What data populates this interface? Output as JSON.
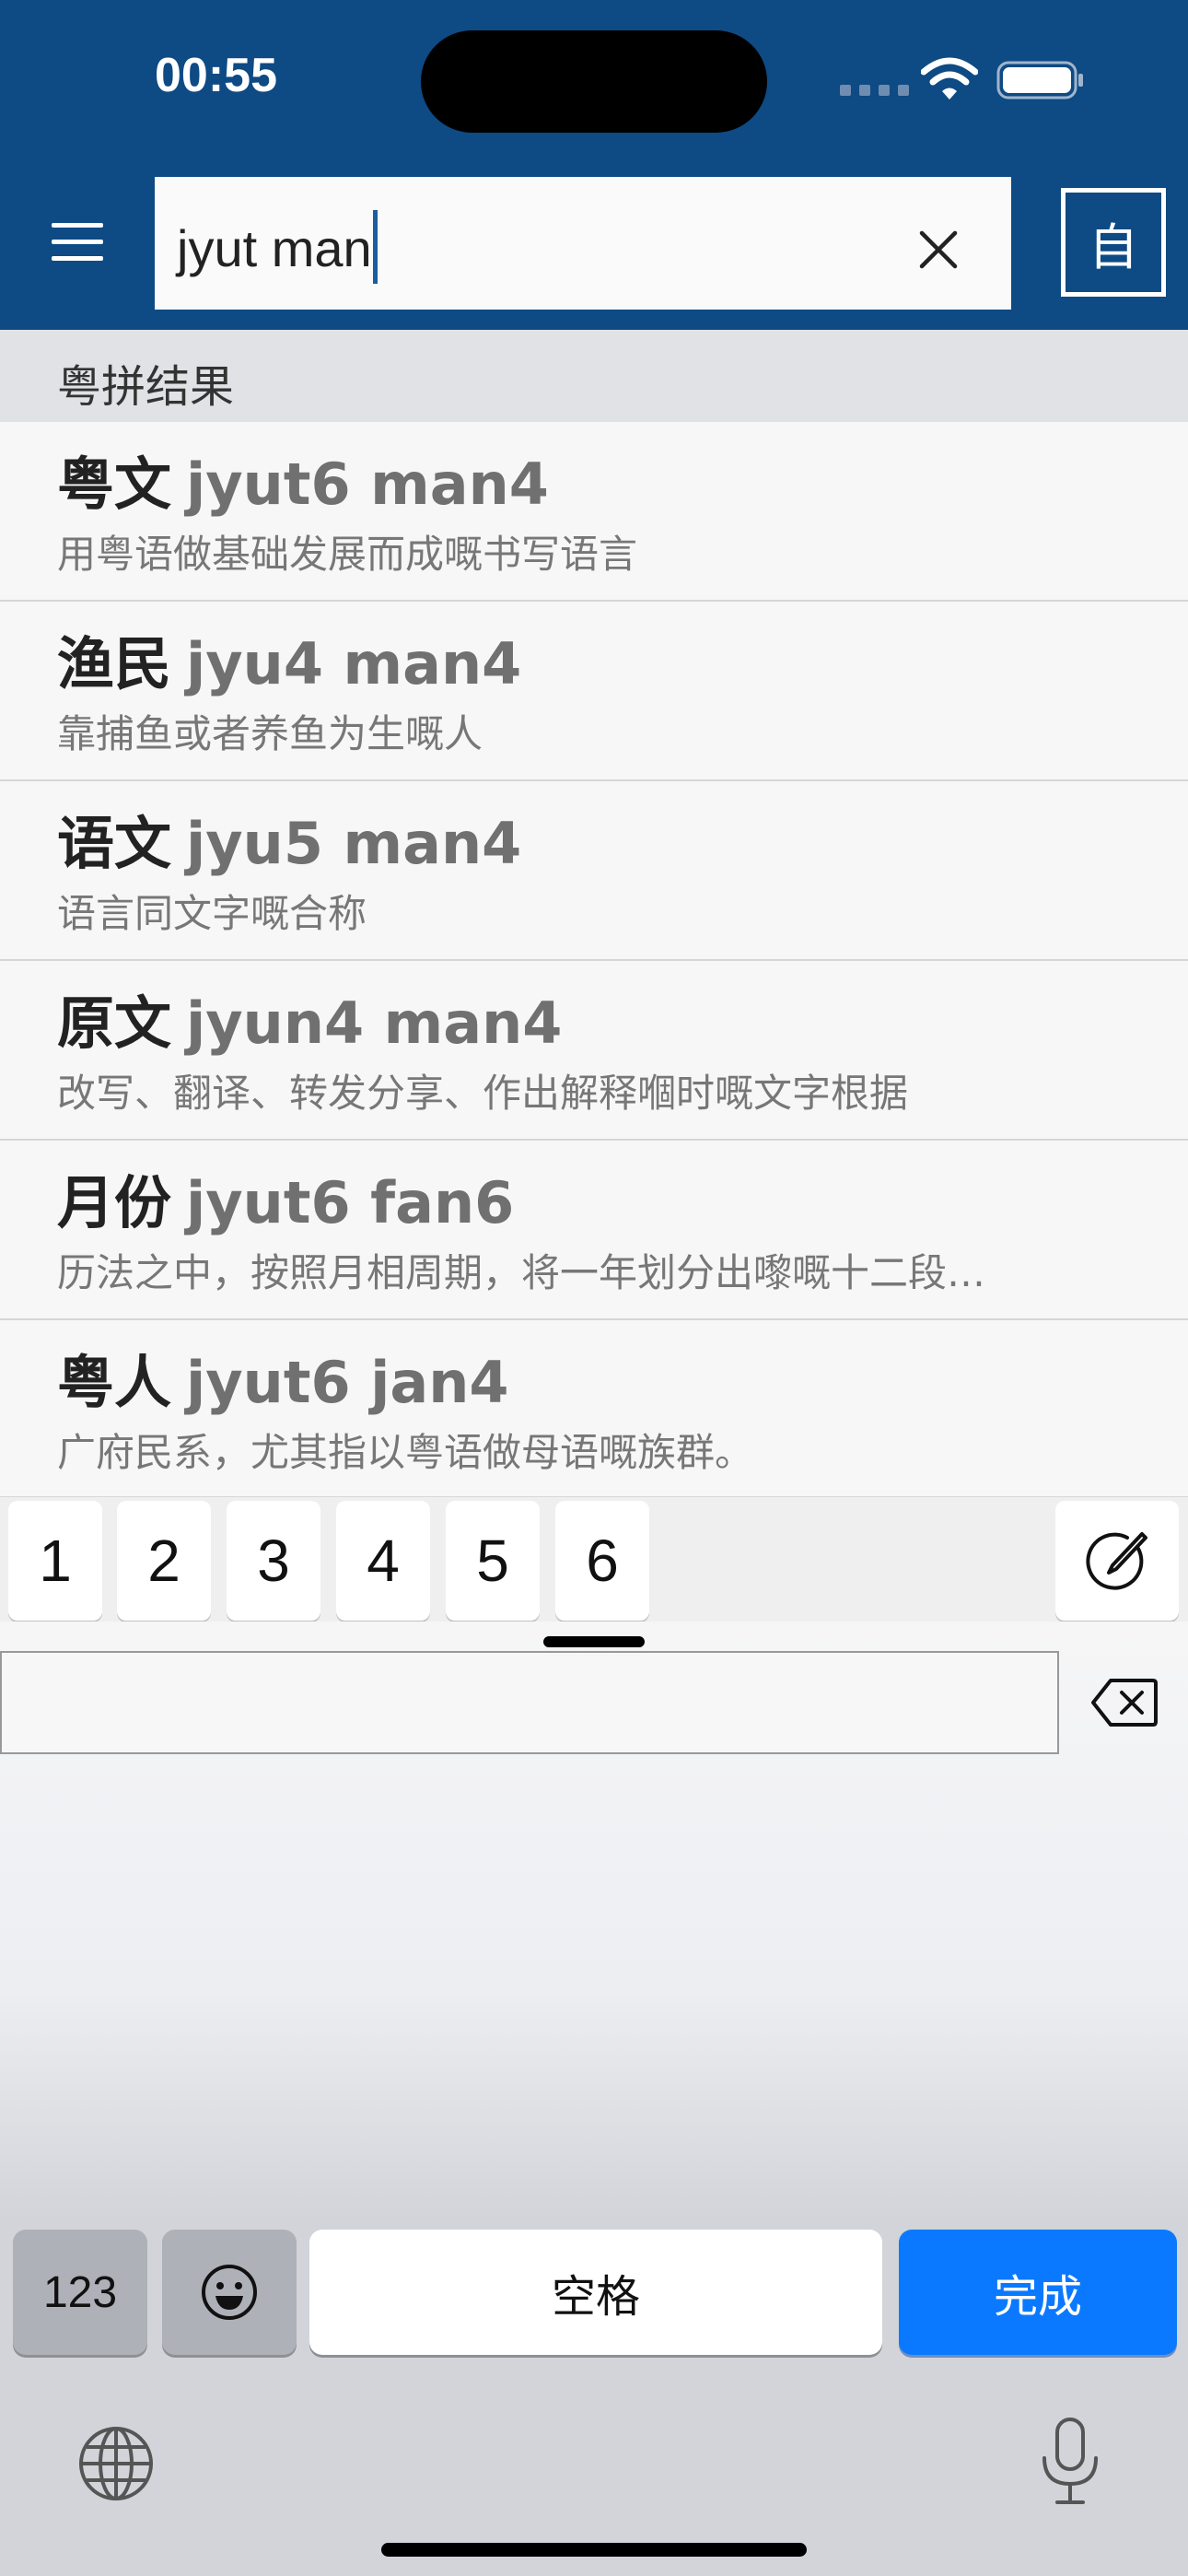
{
  "status_bar": {
    "time": "00:55"
  },
  "search": {
    "query": "jyut man",
    "mode_button": "自"
  },
  "results_section": {
    "title": "粤拼结果",
    "items": [
      {
        "word": "粤文",
        "jyutping": "jyut6 man4",
        "definition": "用粤语做基础发展而成嘅书写语言"
      },
      {
        "word": "渔民",
        "jyutping": "jyu4 man4",
        "definition": "靠捕鱼或者养鱼为生嘅人"
      },
      {
        "word": "语文",
        "jyutping": "jyu5 man4",
        "definition": "语言同文字嘅合称"
      },
      {
        "word": "原文",
        "jyutping": "jyun4 man4",
        "definition": "改写、翻译、转发分享、作出解释嗰时嘅文字根据"
      },
      {
        "word": "月份",
        "jyutping": "jyut6 fan6",
        "definition": "历法之中，按照月相周期，将一年划分出嚟嘅十二段…"
      },
      {
        "word": "粤人",
        "jyutping": "jyut6 jan4",
        "definition": "广府民系，尤其指以粤语做母语嘅族群。"
      }
    ]
  },
  "tone_keys": [
    "1",
    "2",
    "3",
    "4",
    "5",
    "6"
  ],
  "keyboard": {
    "numbers_key": "123",
    "space_key": "空格",
    "done_key": "完成",
    "accent_color": "#0b79ff"
  },
  "colors": {
    "header": "#0e4a84"
  },
  "icons": [
    "menu-icon",
    "clear-icon",
    "handwriting-icon",
    "delete-icon",
    "emoji-icon",
    "globe-icon",
    "microphone-icon",
    "wifi-icon",
    "battery-icon"
  ]
}
